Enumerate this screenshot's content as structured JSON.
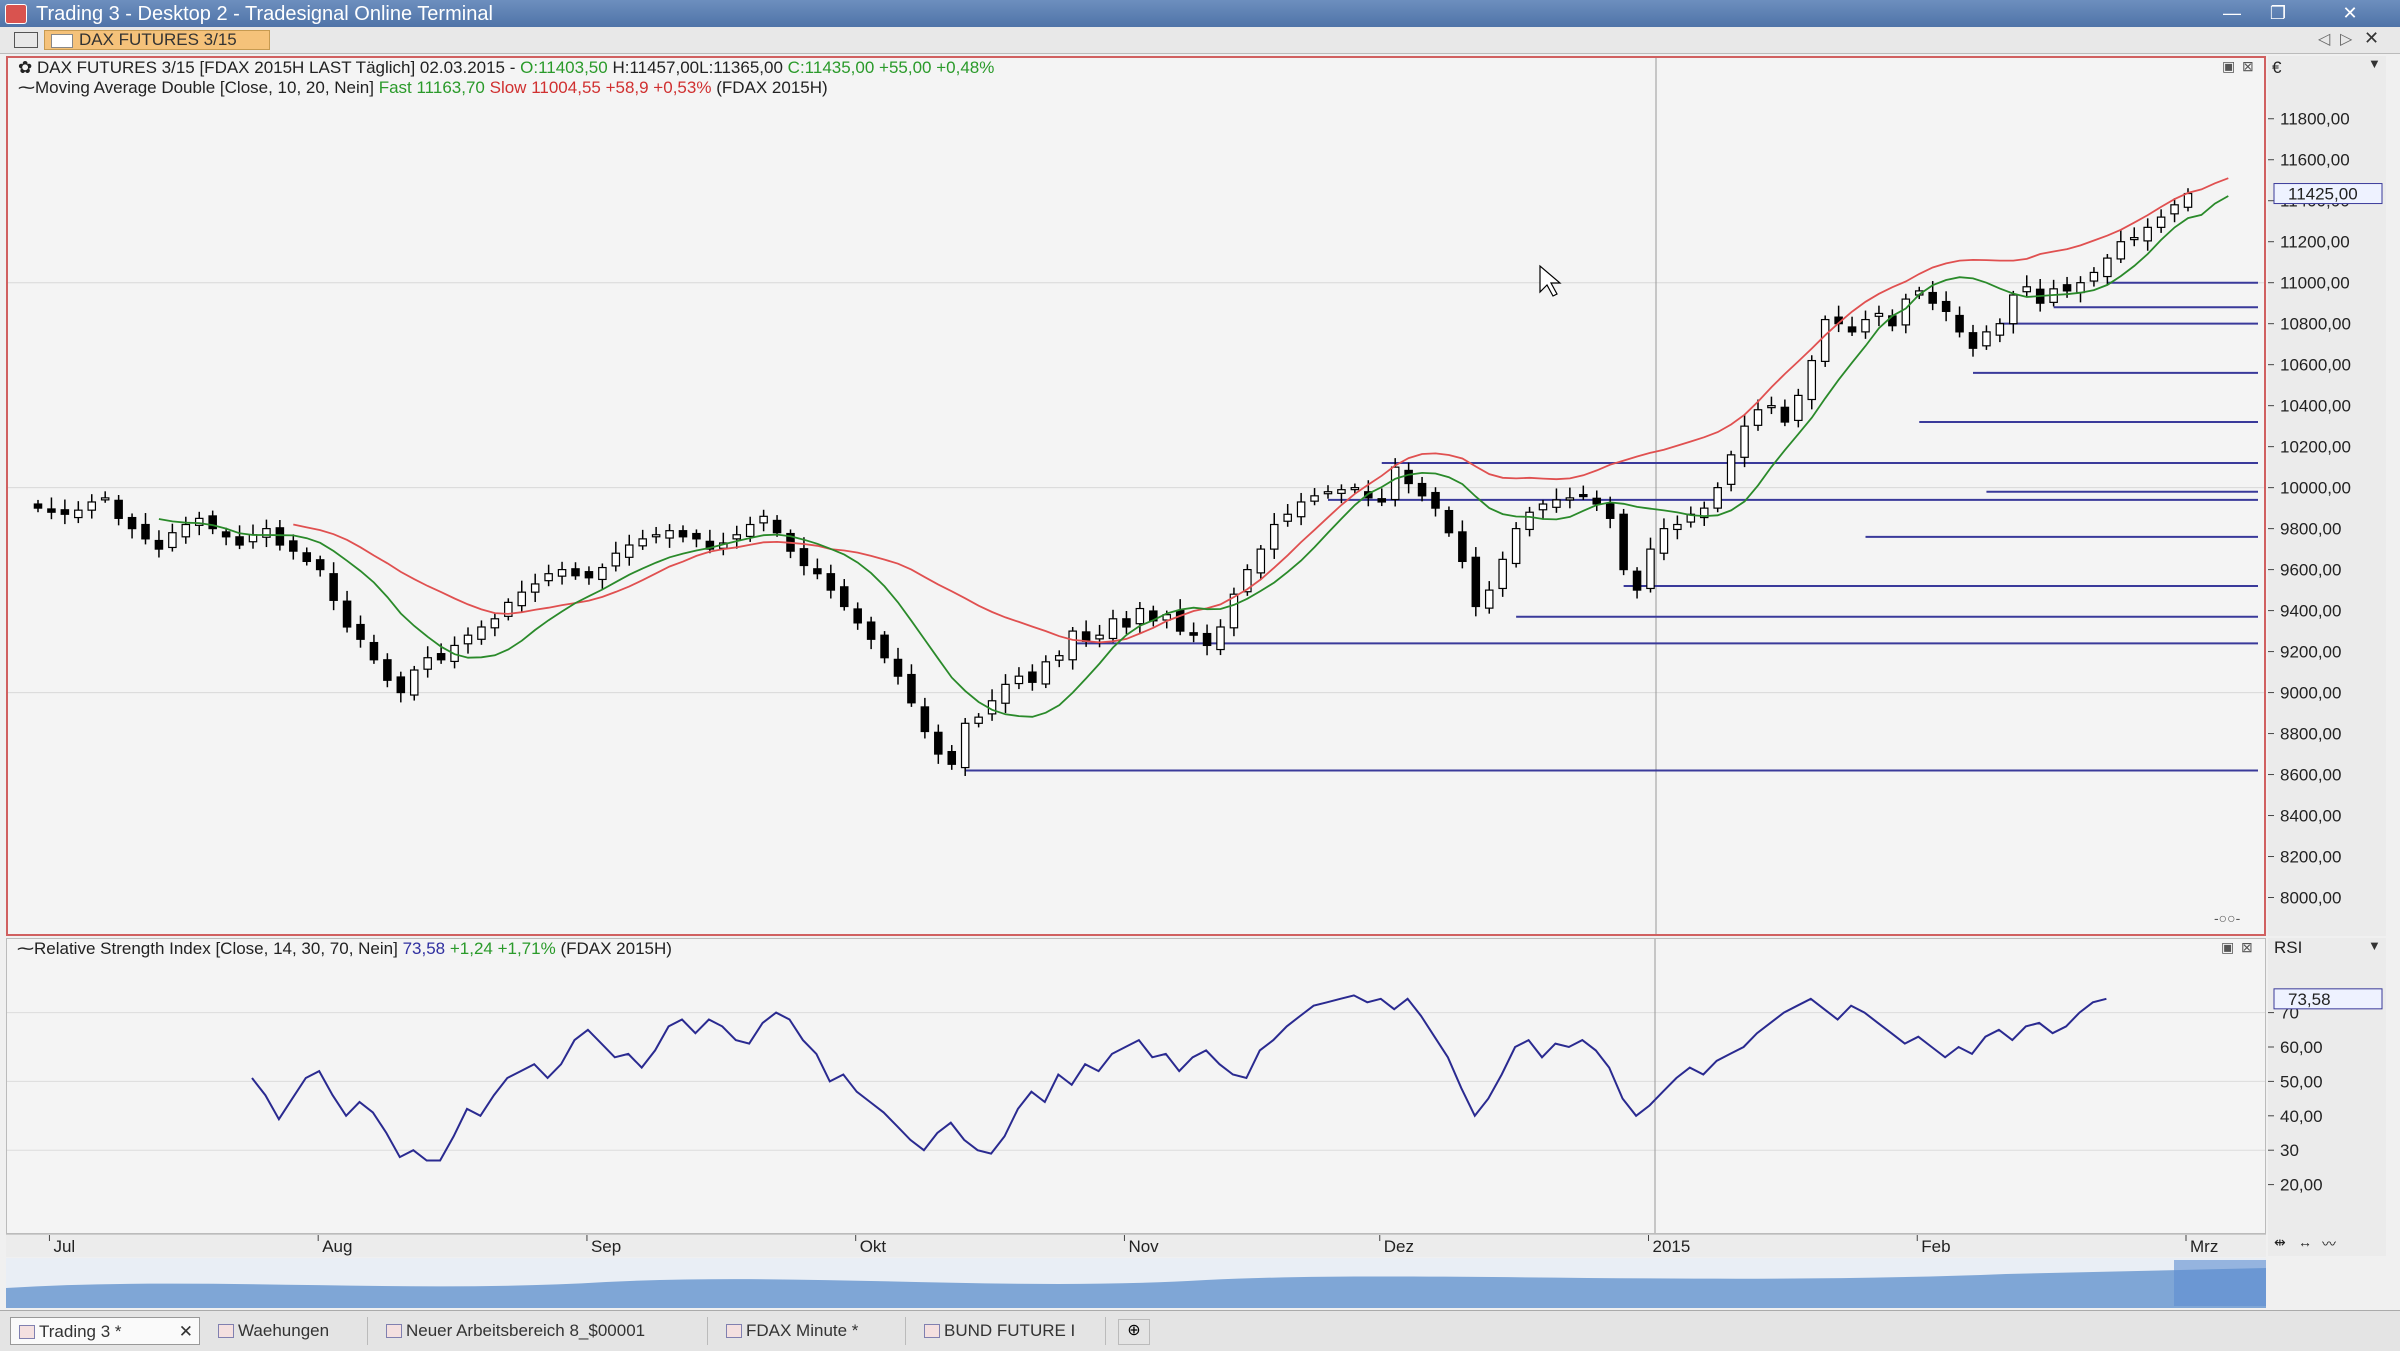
{
  "window": {
    "title": "Trading 3 - Desktop 2 - Tradesignal Online Terminal",
    "controls": [
      "—",
      "❐",
      "✕"
    ]
  },
  "instrument_tab": {
    "label": "DAX FUTURES 3/15"
  },
  "price_pane": {
    "header": {
      "prefix": "DAX FUTURES 3/15 [FDAX 2015H LAST Täglich] 02.03.2015 - ",
      "open": "O:11403,50",
      "high": "H:11457,00",
      "low": "L:11365,00",
      "close": "C:11435,00 +55,00 +0,48%"
    },
    "indicator": {
      "name": "Moving Average Double [Close, 10, 20, Nein]",
      "fast_label": "Fast",
      "fast_value": "11163,70",
      "slow_label": "Slow",
      "slow_value": "11004,55 +58,9 +0,53%",
      "symbol": "(FDAX 2015H)"
    },
    "currency_label": "€",
    "current_price_tag": "11425,00"
  },
  "rsi_pane": {
    "header": {
      "name": "Relative Strength Index [Close, 14, 30, 70, Nein]",
      "value": "73,58",
      "change": "+1,24 +1,71%",
      "symbol": "(FDAX 2015H)"
    },
    "axis_title": "RSI",
    "current_tag": "73,58"
  },
  "time_axis": {
    "labels": [
      "Jul",
      "Aug",
      "Sep",
      "Okt",
      "Nov",
      "Dez",
      "2015",
      "Feb",
      "Mrz"
    ]
  },
  "bottom_tabs": [
    {
      "label": "Trading 3 *",
      "active": true
    },
    {
      "label": "Waehungen",
      "active": false
    },
    {
      "label": "Neuer Arbeitsbereich 8_$00001",
      "active": false
    },
    {
      "label": "FDAX Minute *",
      "active": false
    },
    {
      "label": "BUND FUTURE I",
      "active": false
    }
  ],
  "colors": {
    "candle_up": "#ffffff",
    "candle_down": "#000000",
    "ma_fast": "#2a8a2a",
    "ma_slow": "#e05050",
    "rsi_line": "#2a2a90",
    "support_lines": "#3a3a9a",
    "pane_border": "#d06060"
  },
  "chart_data": [
    {
      "type": "candlestick",
      "title": "DAX FUTURES 3/15",
      "ylim": [
        7900,
        11950
      ],
      "yticks": [
        8000,
        8200,
        8400,
        8600,
        8800,
        9000,
        9200,
        9400,
        9600,
        9800,
        10000,
        10200,
        10400,
        10600,
        10800,
        11000,
        11200,
        11400,
        11600,
        11800
      ],
      "ytick_labels": [
        "8000,00",
        "8200,00",
        "8400,00",
        "8600,00",
        "8800,00",
        "9000,00",
        "9200,00",
        "9400,00",
        "9600,00",
        "9800,00",
        "10000,00",
        "10200,00",
        "10400,00",
        "10600,00",
        "10800,00",
        "11000,00",
        "11200,00",
        "11400,00",
        "11600,00",
        "11800,00"
      ],
      "close": [
        9900,
        9880,
        9870,
        9890,
        9930,
        9950,
        9850,
        9800,
        9750,
        9700,
        9780,
        9820,
        9850,
        9800,
        9760,
        9720,
        9770,
        9800,
        9720,
        9690,
        9640,
        9600,
        9450,
        9320,
        9260,
        9160,
        9060,
        9000,
        9110,
        9170,
        9160,
        9230,
        9280,
        9320,
        9360,
        9440,
        9490,
        9530,
        9580,
        9600,
        9570,
        9560,
        9610,
        9680,
        9720,
        9750,
        9770,
        9790,
        9760,
        9750,
        9700,
        9730,
        9770,
        9820,
        9860,
        9780,
        9690,
        9620,
        9580,
        9500,
        9420,
        9340,
        9260,
        9170,
        9080,
        8950,
        8810,
        8700,
        8650,
        8850,
        8880,
        8960,
        9040,
        9080,
        9050,
        9150,
        9180,
        9300,
        9250,
        9280,
        9360,
        9320,
        9410,
        9350,
        9380,
        9300,
        9280,
        9230,
        9320,
        9480,
        9600,
        9700,
        9820,
        9870,
        9930,
        9960,
        9980,
        9990,
        10000,
        9950,
        9930,
        10100,
        10020,
        9960,
        9900,
        9780,
        9640,
        9420,
        9500,
        9650,
        9800,
        9880,
        9920,
        9940,
        9950,
        9960,
        9920,
        9850,
        9600,
        9500,
        9700,
        9800,
        9820,
        9870,
        9900,
        10000,
        10160,
        10300,
        10380,
        10400,
        10320,
        10450,
        10620,
        10820,
        10800,
        10760,
        10820,
        10850,
        10790,
        10920,
        10960,
        10900,
        10860,
        10760,
        10680,
        10760,
        10800,
        10940,
        10980,
        10900,
        10970,
        10960,
        11000,
        11050,
        11120,
        11200,
        11220,
        11270,
        11320,
        11380,
        11435
      ],
      "ma_fast": [
        null,
        null,
        null,
        null,
        null,
        null,
        null,
        null,
        null,
        9847,
        9835,
        9829,
        9827,
        9817,
        9800,
        9777,
        9769,
        9769,
        9768,
        9767,
        9753,
        9731,
        9691,
        9643,
        9593,
        9537,
        9466,
        9386,
        9325,
        9272,
        9224,
        9187,
        9170,
        9172,
        9182,
        9210,
        9253,
        9306,
        9353,
        9396,
        9437,
        9470,
        9503,
        9539,
        9575,
        9606,
        9634,
        9660,
        9678,
        9693,
        9706,
        9723,
        9739,
        9754,
        9768,
        9771,
        9763,
        9746,
        9726,
        9701,
        9673,
        9634,
        9583,
        9518,
        9440,
        9350,
        9257,
        9165,
        9073,
        9008,
        8954,
        8916,
        8894,
        8885,
        8882,
        8902,
        8939,
        9000,
        9069,
        9142,
        9220,
        9281,
        9326,
        9353,
        9386,
        9405,
        9414,
        9407,
        9408,
        9428,
        9458,
        9496,
        9537,
        9589,
        9644,
        9710,
        9780,
        9848,
        9915,
        9970,
        10003,
        10043,
        10063,
        10072,
        10069,
        10051,
        10017,
        9956,
        9900,
        9871,
        9859,
        9857,
        9847,
        9845,
        9857,
        9887,
        9915,
        9928,
        9921,
        9906,
        9897,
        9889,
        9879,
        9866,
        9861,
        9865,
        9889,
        9933,
        10011,
        10101,
        10183,
        10261,
        10341,
        10436,
        10526,
        10610,
        10691,
        10778,
        10838,
        10874,
        10943,
        10988,
        11013,
        11027,
        11021,
        11000,
        10971,
        10947,
        10930,
        10935,
        10940,
        10944,
        10951,
        10964,
        10989,
        11032,
        11082,
        11140,
        11209,
        11270,
        11315,
        11331,
        11386,
        11423
      ],
      "ma_slow": [
        null,
        null,
        null,
        null,
        null,
        null,
        null,
        null,
        null,
        null,
        null,
        null,
        null,
        null,
        null,
        null,
        null,
        null,
        null,
        9820,
        9806,
        9793,
        9773,
        9745,
        9709,
        9669,
        9631,
        9589,
        9553,
        9520,
        9490,
        9459,
        9430,
        9406,
        9388,
        9384,
        9392,
        9404,
        9414,
        9427,
        9437,
        9449,
        9467,
        9491,
        9518,
        9549,
        9582,
        9615,
        9639,
        9667,
        9688,
        9700,
        9709,
        9721,
        9733,
        9735,
        9731,
        9725,
        9716,
        9700,
        9693,
        9683,
        9667,
        9649,
        9629,
        9600,
        9563,
        9527,
        9494,
        9460,
        9424,
        9393,
        9367,
        9345,
        9322,
        9300,
        9275,
        9257,
        9251,
        9245,
        9250,
        9262,
        9288,
        9316,
        9349,
        9374,
        9398,
        9411,
        9430,
        9466,
        9505,
        9552,
        9610,
        9670,
        9734,
        9794,
        9855,
        9915,
        9970,
        10015,
        10058,
        10108,
        10144,
        10164,
        10167,
        10159,
        10142,
        10103,
        10066,
        10048,
        10045,
        10048,
        10044,
        10041,
        10045,
        10060,
        10084,
        10112,
        10132,
        10152,
        10170,
        10185,
        10205,
        10225,
        10246,
        10271,
        10308,
        10356,
        10420,
        10490,
        10555,
        10616,
        10679,
        10744,
        10803,
        10859,
        10907,
        10946,
        10978,
        11006,
        11043,
        11074,
        11094,
        11108,
        11111,
        11110,
        11108,
        11108,
        11116,
        11140,
        11152,
        11164,
        11182,
        11206,
        11230,
        11258,
        11293,
        11330,
        11370,
        11408,
        11438,
        11455,
        11485,
        11510
      ]
    },
    {
      "type": "line",
      "title": "Relative Strength Index",
      "ylim": [
        10,
        85
      ],
      "yticks": [
        20,
        30,
        40,
        50,
        60,
        70
      ],
      "ytick_labels": [
        "20,00",
        "30",
        "40,00",
        "50,00",
        "60,00",
        "70"
      ],
      "x_start_index": 16,
      "values": [
        51,
        46,
        39,
        45,
        51,
        53,
        46,
        40,
        44,
        41,
        35,
        28,
        30,
        27,
        27,
        34,
        42,
        40,
        46,
        51,
        53,
        55,
        51,
        55,
        62,
        65,
        61,
        57,
        58,
        54,
        59,
        66,
        68,
        64,
        68,
        66,
        62,
        61,
        67,
        70,
        68,
        62,
        58,
        50,
        52,
        47,
        44,
        41,
        37,
        33,
        30,
        35,
        38,
        33,
        30,
        29,
        34,
        42,
        47,
        44,
        52,
        49,
        55,
        53,
        58,
        60,
        62,
        57,
        58,
        53,
        57,
        59,
        55,
        52,
        51,
        59,
        62,
        66,
        69,
        72,
        73,
        74,
        75,
        73,
        74,
        71,
        74,
        69,
        63,
        57,
        48,
        40,
        45,
        52,
        60,
        62,
        57,
        61,
        60,
        62,
        59,
        54,
        45,
        40,
        43,
        47,
        51,
        54,
        52,
        56,
        58,
        60,
        64,
        67,
        70,
        72,
        74,
        71,
        68,
        72,
        70,
        67,
        64,
        61,
        63,
        60,
        57,
        60,
        58,
        63,
        65,
        62,
        66,
        67,
        64,
        66,
        70,
        73,
        74
      ]
    }
  ]
}
